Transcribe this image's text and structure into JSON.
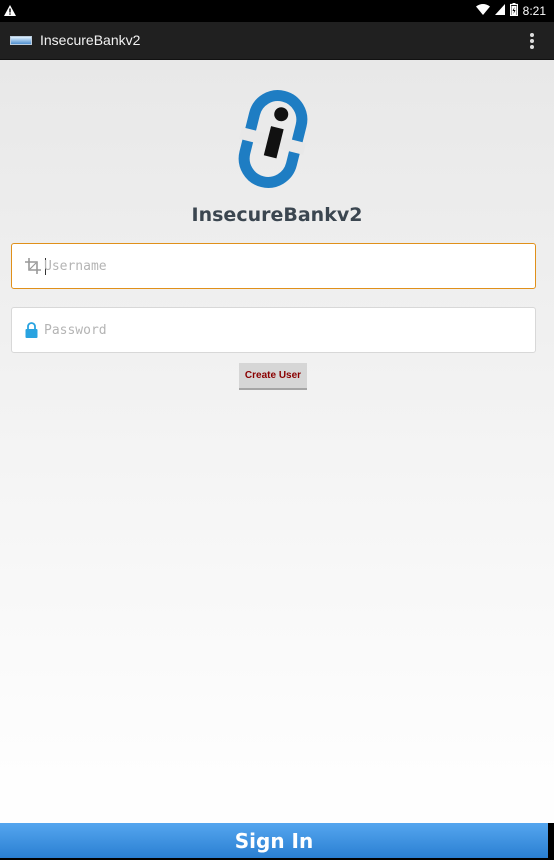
{
  "status_bar": {
    "time": "8:21"
  },
  "action_bar": {
    "title": "InsecureBankv2"
  },
  "main": {
    "brand_name": "InsecureBankv2",
    "username_placeholder": "Username",
    "password_placeholder": "Password",
    "create_user_label": "Create User",
    "sign_in_label": "Sign In"
  },
  "colors": {
    "accent_focus": "#e0901a",
    "logo_blue": "#1e7dc3",
    "sign_in_blue": "#3a8fe0",
    "create_user_text": "#8a0000"
  }
}
